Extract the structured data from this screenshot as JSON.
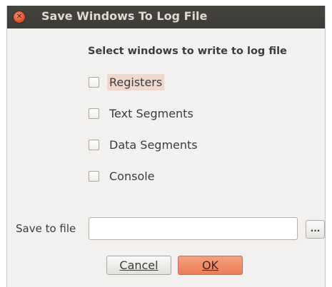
{
  "window": {
    "title": "Save Windows To Log File",
    "close_icon": "close-icon"
  },
  "heading": "Select windows to write to log file",
  "checkboxes": [
    {
      "label": "Registers",
      "checked": false,
      "focused": true
    },
    {
      "label": "Text Segments",
      "checked": false,
      "focused": false
    },
    {
      "label": "Data Segments",
      "checked": false,
      "focused": false
    },
    {
      "label": "Console",
      "checked": false,
      "focused": false
    }
  ],
  "save": {
    "label": "Save to file",
    "value": "",
    "browse_label": "..."
  },
  "buttons": {
    "cancel": "Cancel",
    "ok": "OK"
  },
  "colors": {
    "titlebar": "#3c3b37",
    "close": "#df4a1f",
    "ok_button": "#ec7e58",
    "focus_highlight": "#f0d8cf"
  }
}
